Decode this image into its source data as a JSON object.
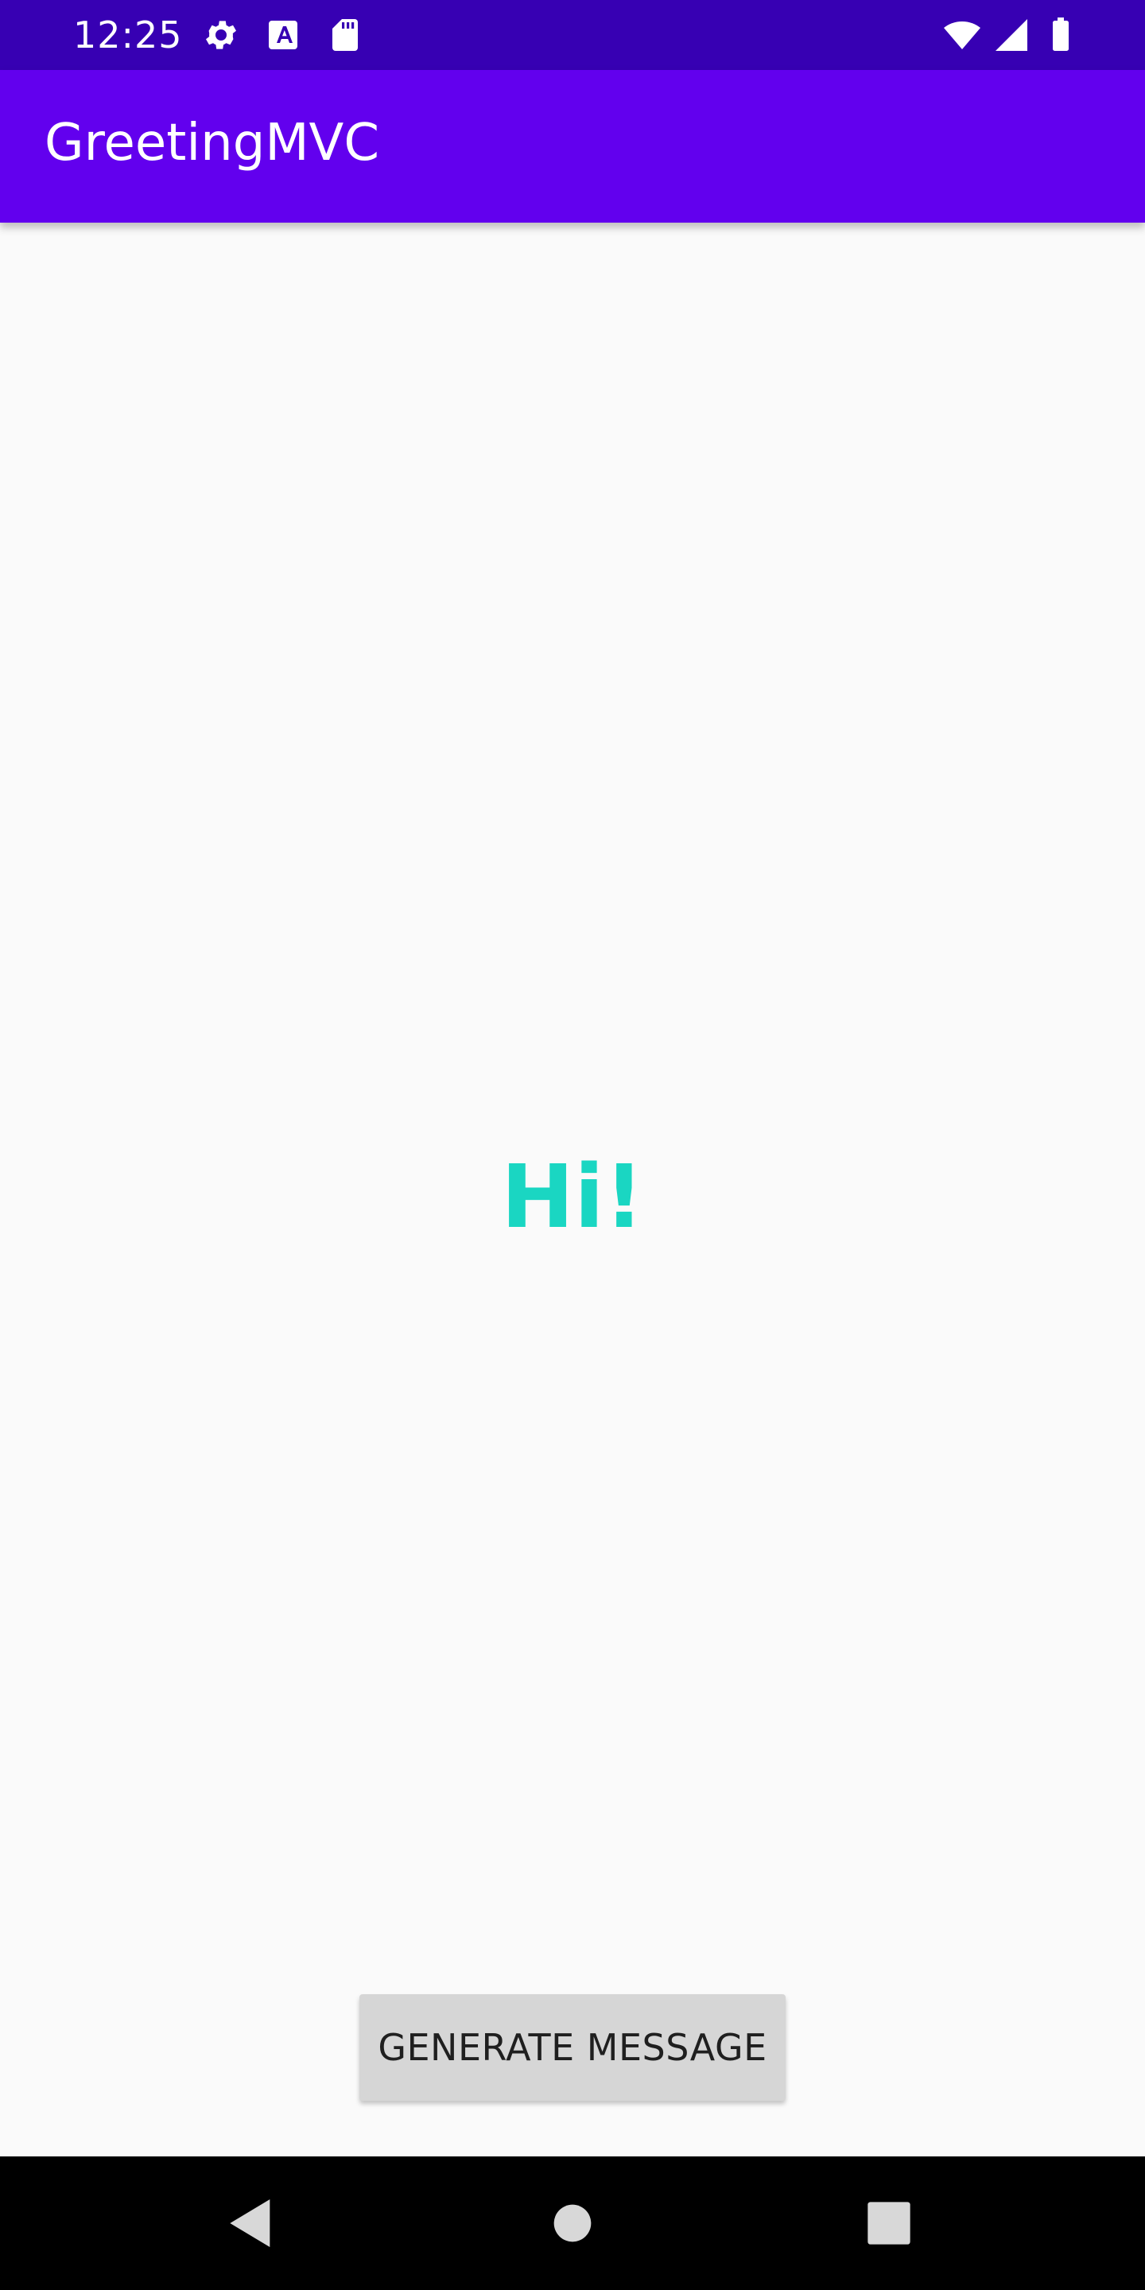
{
  "status_bar": {
    "time": "12:25",
    "icons": [
      "gear-icon",
      "text-a-icon",
      "sd-card-icon",
      "wifi-icon",
      "signal-icon",
      "battery-icon"
    ],
    "background_color": "#3700b3"
  },
  "app_bar": {
    "title": "GreetingMVC",
    "background_color": "#6200ee"
  },
  "main": {
    "greeting_text": "Hi!",
    "greeting_color": "#1ad6c2",
    "button_label": "GENERATE MESSAGE"
  },
  "nav_bar": {
    "buttons": [
      "back-icon",
      "home-icon",
      "recents-icon"
    ]
  }
}
